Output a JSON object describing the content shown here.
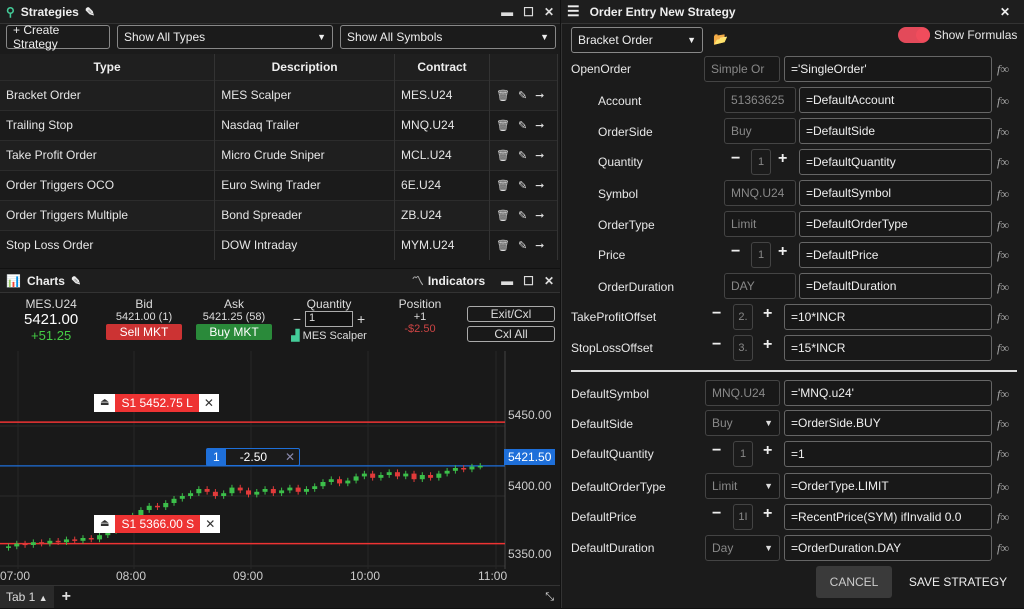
{
  "strategies": {
    "title": "Strategies",
    "create_label": "+ Create Strategy",
    "types_value": "Show All Types",
    "symbols_value": "Show All Symbols",
    "columns": [
      "Type",
      "Description",
      "Contract"
    ],
    "rows": [
      {
        "type": "Bracket Order",
        "desc": "MES Scalper",
        "contract": "MES.U24"
      },
      {
        "type": "Trailing Stop",
        "desc": "Nasdaq Trailer",
        "contract": "MNQ.U24"
      },
      {
        "type": "Take Profit Order",
        "desc": "Micro Crude Sniper",
        "contract": "MCL.U24"
      },
      {
        "type": "Order Triggers OCO",
        "desc": "Euro Swing Trader",
        "contract": "6E.U24"
      },
      {
        "type": "Order Triggers Multiple",
        "desc": "Bond Spreader",
        "contract": "ZB.U24"
      },
      {
        "type": "Stop Loss Order",
        "desc": "DOW Intraday",
        "contract": "MYM.U24"
      }
    ]
  },
  "charts": {
    "title": "Charts",
    "indicators": "Indicators",
    "symbol": "MES.U24",
    "last": "5421.00",
    "change": "+51.25",
    "bid_label": "Bid",
    "bid_value": "5421.00 (1)",
    "sell_label": "Sell MKT",
    "ask_label": "Ask",
    "ask_value": "5421.25 (58)",
    "buy_label": "Buy MKT",
    "qty_label": "Quantity",
    "qty_value": "1",
    "strategy_name": "MES Scalper",
    "pos_label": "Position",
    "pos_value": "+1",
    "pnl": "-$2.50",
    "exit_label": "Exit/Cxl",
    "cxlall_label": "Cxl All",
    "order_top": "S1 5452.75 L",
    "order_bottom": "S1 5366.00 S",
    "pos_qty": "1",
    "pos_pnl": "-2.50",
    "current_price": "5421.50",
    "price_ticks": [
      "5450.00",
      "5400.00",
      "5350.00"
    ],
    "time_ticks": [
      "07:00",
      "08:00",
      "09:00",
      "10:00",
      "11:00"
    ],
    "tab_label": "Tab 1",
    "add_tab": "+"
  },
  "chart_data": {
    "type": "candlestick",
    "y_ticks": [
      5350,
      5400,
      5450
    ],
    "x_ticks": [
      "07:00",
      "08:00",
      "09:00",
      "10:00",
      "11:00"
    ],
    "current": 5421.5,
    "stop": 5366.0,
    "target": 5452.75,
    "closes": [
      5364,
      5366,
      5365,
      5367,
      5366,
      5368,
      5367,
      5369,
      5368,
      5370,
      5369,
      5372,
      5375,
      5378,
      5382,
      5386,
      5390,
      5393,
      5392,
      5395,
      5398,
      5400,
      5402,
      5405,
      5403,
      5400,
      5402,
      5406,
      5404,
      5401,
      5403,
      5405,
      5402,
      5404,
      5406,
      5403,
      5405,
      5407,
      5410,
      5412,
      5409,
      5411,
      5414,
      5416,
      5413,
      5415,
      5417,
      5414,
      5416,
      5412,
      5415,
      5413,
      5416,
      5418,
      5420,
      5419,
      5421,
      5421.5
    ]
  },
  "order_entry": {
    "title": "Order Entry New Strategy",
    "type_value": "Bracket Order",
    "show_formulas": "Show Formulas",
    "open_order_label": "OpenOrder",
    "open_order_type": "Simple Or",
    "open_order_formula": "='SingleOrder'",
    "rows": [
      {
        "label": "Account",
        "ghost": "51363625",
        "formula": "=DefaultAccount"
      },
      {
        "label": "OrderSide",
        "ghost": "Buy",
        "formula": "=DefaultSide"
      },
      {
        "label": "Quantity",
        "ghost": "1",
        "formula": "=DefaultQuantity"
      },
      {
        "label": "Symbol",
        "ghost": "MNQ.U24",
        "formula": "=DefaultSymbol"
      },
      {
        "label": "OrderType",
        "ghost": "Limit",
        "formula": "=DefaultOrderType"
      },
      {
        "label": "Price",
        "ghost": "1",
        "formula": "=DefaultPrice"
      },
      {
        "label": "OrderDuration",
        "ghost": "DAY",
        "formula": "=DefaultDuration"
      }
    ],
    "tp_label": "TakeProfitOffset",
    "tp_val": "2.",
    "tp_formula": "=10*INCR",
    "sl_label": "StopLossOffset",
    "sl_val": "3.",
    "sl_formula": "=15*INCR",
    "defaults": [
      {
        "label": "DefaultSymbol",
        "ghost": "MNQ.U24",
        "formula": "='MNQ.u24'"
      },
      {
        "label": "DefaultSide",
        "ghost": "Buy",
        "formula": "=OrderSide.BUY"
      },
      {
        "label": "DefaultQuantity",
        "ghost": "1",
        "formula": "=1"
      },
      {
        "label": "DefaultOrderType",
        "ghost": "Limit",
        "formula": "=OrderType.LIMIT"
      },
      {
        "label": "DefaultPrice",
        "ghost": "1I",
        "formula": "=RecentPrice(SYM) ifInvalid 0.0"
      },
      {
        "label": "DefaultDuration",
        "ghost": "Day",
        "formula": "=OrderDuration.DAY"
      }
    ],
    "fx": "f∞",
    "cancel": "CANCEL",
    "save": "SAVE STRATEGY"
  }
}
